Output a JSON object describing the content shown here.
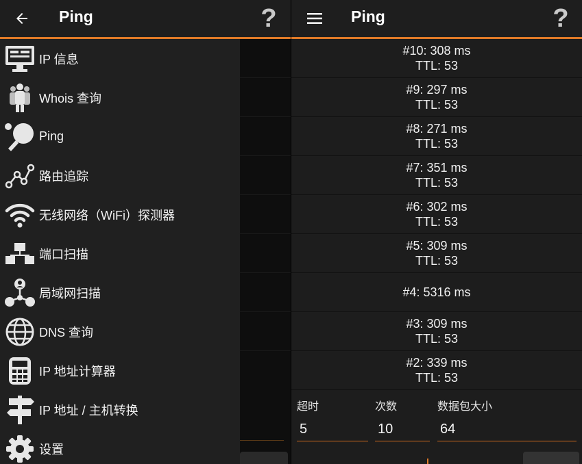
{
  "left_panel": {
    "title": "Ping",
    "help_glyph": "?",
    "drawer": {
      "items": [
        {
          "label": "IP 信息",
          "icon": "monitor-icon"
        },
        {
          "label": "Whois 查询",
          "icon": "people-icon"
        },
        {
          "label": "Ping",
          "icon": "ping-pong-icon"
        },
        {
          "label": "路由追踪",
          "icon": "route-graph-icon"
        },
        {
          "label": "无线网络（WiFi）探测器",
          "icon": "wifi-icon"
        },
        {
          "label": "端口扫描",
          "icon": "network-hierarchy-icon"
        },
        {
          "label": "局域网扫描",
          "icon": "lan-users-icon"
        },
        {
          "label": "DNS 查询",
          "icon": "globe-icon"
        },
        {
          "label": "IP 地址计算器",
          "icon": "calculator-icon"
        },
        {
          "label": "IP 地址 / 主机转换",
          "icon": "signpost-icon"
        },
        {
          "label": "设置",
          "icon": "gear-icon"
        }
      ]
    }
  },
  "right_panel": {
    "title": "Ping",
    "help_glyph": "?",
    "results": [
      {
        "line1": "#10: 308 ms",
        "line2": "TTL: 53"
      },
      {
        "line1": "#9: 297 ms",
        "line2": "TTL: 53"
      },
      {
        "line1": "#8: 271 ms",
        "line2": "TTL: 53"
      },
      {
        "line1": "#7: 351 ms",
        "line2": "TTL: 53"
      },
      {
        "line1": "#6: 302 ms",
        "line2": "TTL: 53"
      },
      {
        "line1": "#5: 309 ms",
        "line2": "TTL: 53"
      },
      {
        "line1": "#4: 5316 ms"
      },
      {
        "line1": "#3: 309 ms",
        "line2": "TTL: 53"
      },
      {
        "line1": "#2: 339 ms",
        "line2": "TTL: 53"
      }
    ],
    "inputs": {
      "timeout": {
        "label": "超时",
        "value": "5"
      },
      "count": {
        "label": "次数",
        "value": "10"
      },
      "packet_size": {
        "label": "数据包大小",
        "value": "64"
      }
    }
  },
  "colors": {
    "accent": "#e07a27",
    "drawer_bg": "#202020",
    "list_bg": "#1d1d1d"
  }
}
